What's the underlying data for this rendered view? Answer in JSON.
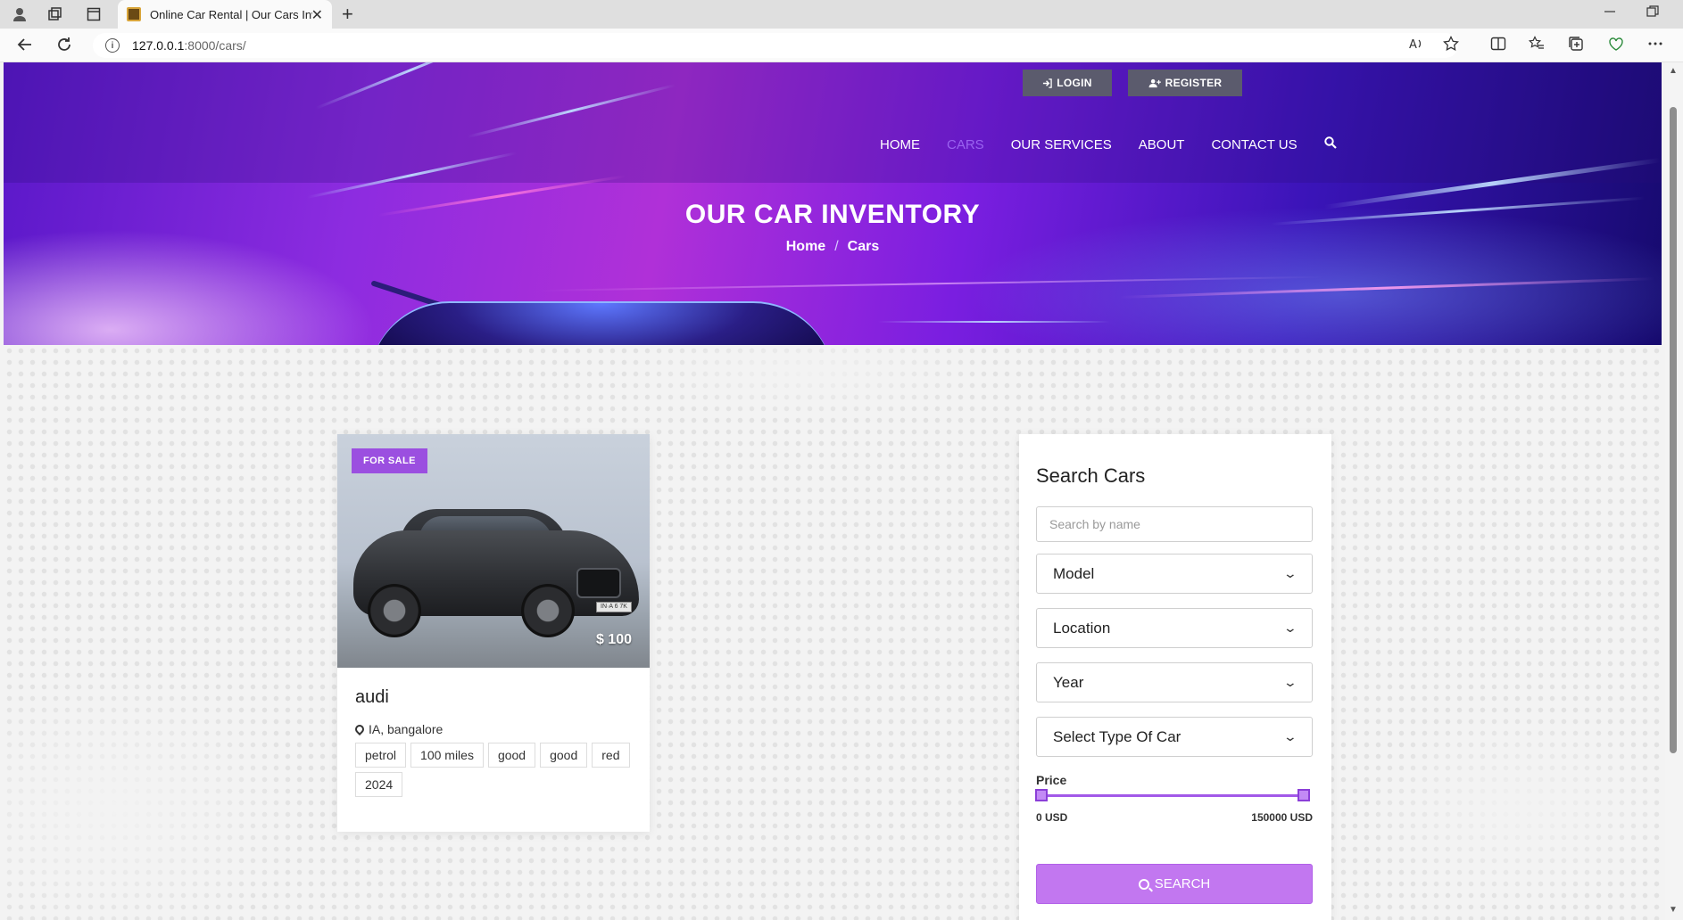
{
  "browser": {
    "tab_title": "Online Car Rental | Our Cars Inventory",
    "tab_close": "✕",
    "new_tab": "+",
    "url_host": "127.0.0.1",
    "url_path": ":8000/cars/"
  },
  "header": {
    "login_label": "LOGIN",
    "register_label": "REGISTER",
    "nav": [
      "HOME",
      "CARS",
      "OUR SERVICES",
      "ABOUT",
      "CONTACT US"
    ],
    "active_nav": "CARS",
    "title": "OUR CAR INVENTORY",
    "breadcrumb": {
      "home": "Home",
      "separator": "/",
      "current": "Cars"
    }
  },
  "car": {
    "badge": "FOR SALE",
    "price": "$ 100",
    "name": "audi",
    "location": "IA, bangalore",
    "plate": "IN·A 6 7K",
    "tags": [
      "petrol",
      "100 miles",
      "good",
      "good",
      "red",
      "2024"
    ]
  },
  "search": {
    "title": "Search Cars",
    "name_placeholder": "Search by name",
    "model_label": "Model",
    "location_label": "Location",
    "year_label": "Year",
    "type_label": "Select Type Of Car",
    "price_label": "Price",
    "price_min": "0 USD",
    "price_max": "150000 USD",
    "price_range_fraction": [
      0,
      1
    ],
    "button_label": "SEARCH"
  },
  "colors": {
    "accent": "#9b4fe0",
    "active_nav": "#9a63f0",
    "search_button": "#c277f0",
    "auth_button": "#5b5b6d"
  }
}
